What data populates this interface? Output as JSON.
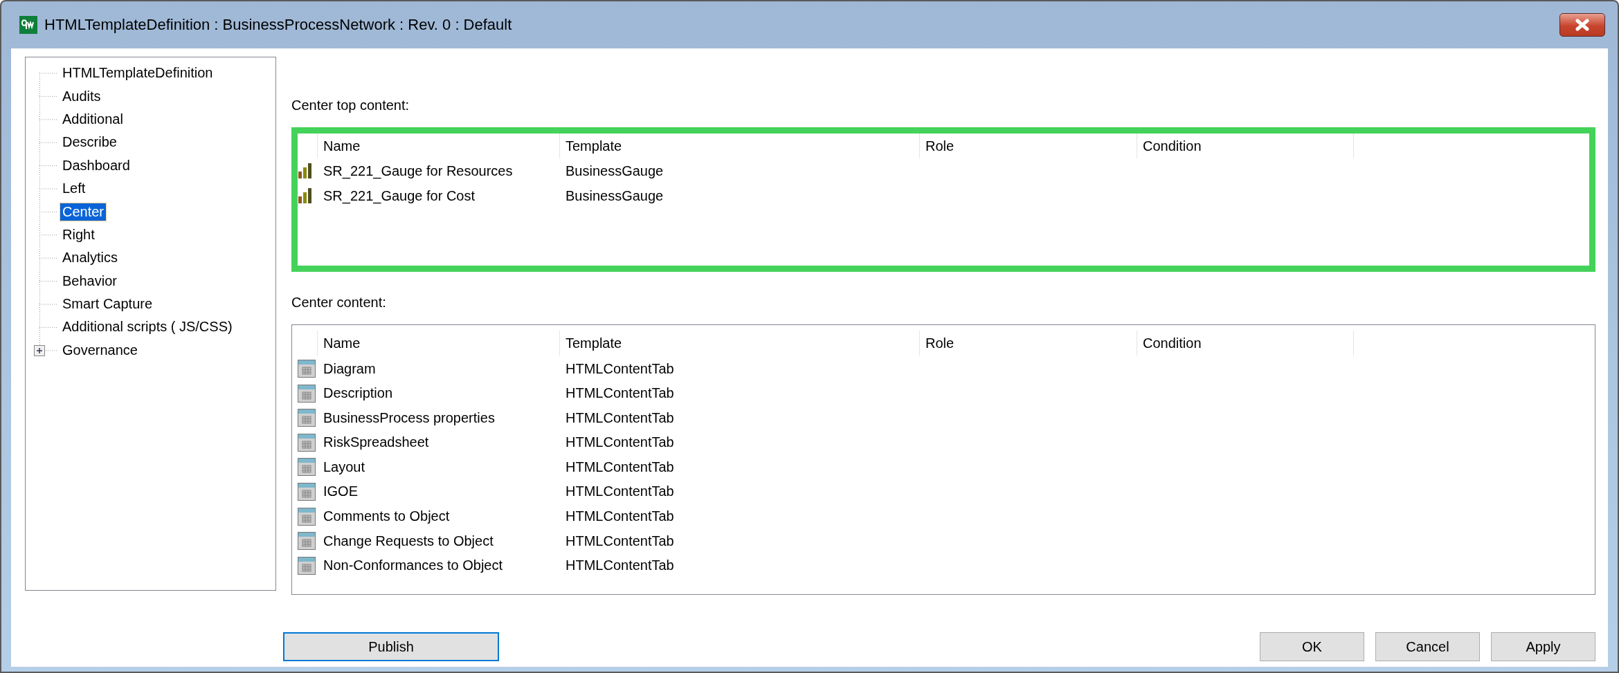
{
  "window": {
    "title": "HTMLTemplateDefinition : BusinessProcessNetwork : Rev. 0  : Default"
  },
  "tree": {
    "items": [
      {
        "label": "HTMLTemplateDefinition",
        "kind": "leaf",
        "selected": false
      },
      {
        "label": "Audits",
        "kind": "leaf",
        "selected": false
      },
      {
        "label": "Additional",
        "kind": "leaf",
        "selected": false
      },
      {
        "label": "Describe",
        "kind": "leaf",
        "selected": false
      },
      {
        "label": "Dashboard",
        "kind": "leaf",
        "selected": false
      },
      {
        "label": "Left",
        "kind": "leaf",
        "selected": false
      },
      {
        "label": "Center",
        "kind": "leaf",
        "selected": true
      },
      {
        "label": "Right",
        "kind": "leaf",
        "selected": false
      },
      {
        "label": "Analytics",
        "kind": "leaf",
        "selected": false
      },
      {
        "label": "Behavior",
        "kind": "leaf",
        "selected": false
      },
      {
        "label": "Smart Capture",
        "kind": "leaf",
        "selected": false
      },
      {
        "label": "Additional scripts ( JS/CSS)",
        "kind": "leaf",
        "selected": false
      },
      {
        "label": "Governance",
        "kind": "branch",
        "expanded": false,
        "selected": false
      }
    ]
  },
  "sections": [
    {
      "label": "Center top content:",
      "highlighted": true,
      "columns": [
        "Name",
        "Template",
        "Role",
        "Condition"
      ],
      "rows": [
        {
          "kind": "gauge",
          "name": "SR_221_Gauge for Resources",
          "template": "BusinessGauge"
        },
        {
          "kind": "gauge",
          "name": "SR_221_Gauge for Cost",
          "template": "BusinessGauge"
        }
      ]
    },
    {
      "label": "Center content:",
      "highlighted": false,
      "columns": [
        "Name",
        "Template",
        "Role",
        "Condition"
      ],
      "rows": [
        {
          "kind": "tab",
          "name": "Diagram",
          "template": "HTMLContentTab"
        },
        {
          "kind": "tab",
          "name": "Description",
          "template": "HTMLContentTab"
        },
        {
          "kind": "tab",
          "name": "BusinessProcess properties",
          "template": "HTMLContentTab"
        },
        {
          "kind": "tab",
          "name": "RiskSpreadsheet",
          "template": "HTMLContentTab"
        },
        {
          "kind": "tab",
          "name": "Layout",
          "template": "HTMLContentTab"
        },
        {
          "kind": "tab",
          "name": "IGOE",
          "template": "HTMLContentTab"
        },
        {
          "kind": "tab",
          "name": "Comments to Object",
          "template": "HTMLContentTab"
        },
        {
          "kind": "tab",
          "name": "Change Requests to Object",
          "template": "HTMLContentTab"
        },
        {
          "kind": "tab",
          "name": "Non-Conformances to Object",
          "template": "HTMLContentTab"
        }
      ]
    }
  ],
  "buttons": [
    {
      "label": "Publish",
      "kind": "left",
      "focused": true
    },
    {
      "label": "OK",
      "kind": "right",
      "focused": false
    },
    {
      "label": "Cancel",
      "kind": "right",
      "focused": false
    },
    {
      "label": "Apply",
      "kind": "right",
      "focused": false
    }
  ]
}
